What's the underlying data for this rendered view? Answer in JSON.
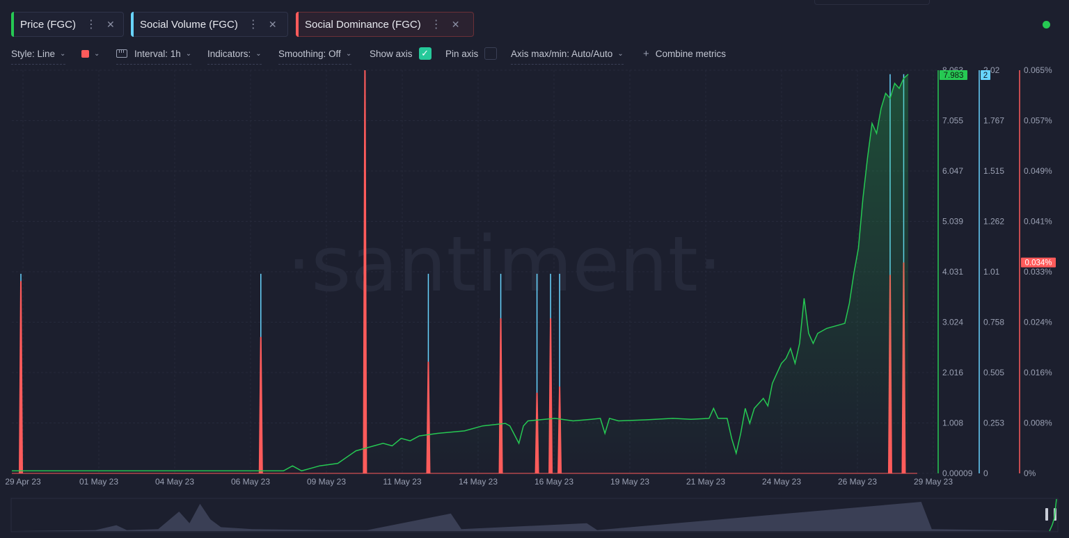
{
  "tabs": [
    {
      "label": "Price (FGC)",
      "color": "#26c953"
    },
    {
      "label": "Social Volume (FGC)",
      "color": "#68d4ff"
    },
    {
      "label": "Social Dominance (FGC)",
      "color": "#ff5b5b"
    }
  ],
  "toolbar": {
    "style_label": "Style: Line",
    "interval_label": "Interval: 1h",
    "indicators_label": "Indicators:",
    "smoothing_label": "Smoothing: Off",
    "show_axis_label": "Show axis",
    "pin_axis_label": "Pin axis",
    "axis_maxmin_label": "Axis max/min: Auto/Auto",
    "combine_label": "Combine metrics",
    "swatch_color": "#ff5b5b",
    "show_axis_checked": true,
    "pin_axis_checked": false
  },
  "status_color": "#26c953",
  "watermark": "·santiment·",
  "chart_data": {
    "type": "line",
    "x_tick_labels": [
      "29 Apr 23",
      "01 May 23",
      "04 May 23",
      "06 May 23",
      "09 May 23",
      "11 May 23",
      "14 May 23",
      "16 May 23",
      "19 May 23",
      "21 May 23",
      "24 May 23",
      "26 May 23",
      "29 May 23"
    ],
    "axes": [
      {
        "metric": "Price (FGC)",
        "color": "#26c953",
        "ticks": [
          "8.063",
          "7.055",
          "6.047",
          "5.039",
          "4.031",
          "3.024",
          "2.016",
          "1.008",
          "0.00009"
        ],
        "range": [
          9e-05,
          8.063
        ],
        "current": "7.983"
      },
      {
        "metric": "Social Volume (FGC)",
        "color": "#68d4ff",
        "ticks": [
          "2.02",
          "1.767",
          "1.515",
          "1.262",
          "1.01",
          "0.758",
          "0.505",
          "0.253",
          "0"
        ],
        "range": [
          0,
          2.02
        ],
        "current": "2"
      },
      {
        "metric": "Social Dominance (FGC)",
        "color": "#ff5b5b",
        "ticks": [
          "0.065%",
          "0.057%",
          "0.049%",
          "0.041%",
          "0.033%",
          "0.024%",
          "0.016%",
          "0.008%",
          "0%"
        ],
        "range": [
          0,
          0.065
        ],
        "current": "0.034%"
      }
    ],
    "series": [
      {
        "name": "Price (FGC)",
        "color": "#26c953",
        "points": [
          [
            0,
            0.05
          ],
          [
            0.3,
            0.05
          ],
          [
            0.31,
            0.15
          ],
          [
            0.32,
            0.05
          ],
          [
            0.33,
            0.1
          ],
          [
            0.34,
            0.15
          ],
          [
            0.36,
            0.2
          ],
          [
            0.38,
            0.45
          ],
          [
            0.39,
            0.5
          ],
          [
            0.41,
            0.6
          ],
          [
            0.42,
            0.55
          ],
          [
            0.43,
            0.7
          ],
          [
            0.44,
            0.65
          ],
          [
            0.45,
            0.75
          ],
          [
            0.47,
            0.8
          ],
          [
            0.5,
            0.85
          ],
          [
            0.52,
            0.95
          ],
          [
            0.545,
            1.0
          ],
          [
            0.55,
            0.95
          ],
          [
            0.56,
            0.6
          ],
          [
            0.565,
            0.95
          ],
          [
            0.57,
            1.05
          ],
          [
            0.6,
            1.1
          ],
          [
            0.62,
            1.05
          ],
          [
            0.64,
            1.08
          ],
          [
            0.65,
            1.1
          ],
          [
            0.655,
            0.8
          ],
          [
            0.66,
            1.1
          ],
          [
            0.67,
            1.05
          ],
          [
            0.7,
            1.07
          ],
          [
            0.73,
            1.1
          ],
          [
            0.75,
            1.08
          ],
          [
            0.77,
            1.1
          ],
          [
            0.775,
            1.3
          ],
          [
            0.78,
            1.1
          ],
          [
            0.79,
            1.1
          ],
          [
            0.795,
            0.7
          ],
          [
            0.8,
            0.4
          ],
          [
            0.805,
            0.8
          ],
          [
            0.81,
            1.3
          ],
          [
            0.815,
            1.0
          ],
          [
            0.82,
            1.3
          ],
          [
            0.83,
            1.5
          ],
          [
            0.835,
            1.35
          ],
          [
            0.84,
            1.8
          ],
          [
            0.845,
            2.0
          ],
          [
            0.85,
            2.2
          ],
          [
            0.855,
            2.3
          ],
          [
            0.86,
            2.5
          ],
          [
            0.865,
            2.2
          ],
          [
            0.87,
            2.6
          ],
          [
            0.875,
            3.5
          ],
          [
            0.88,
            2.8
          ],
          [
            0.885,
            2.6
          ],
          [
            0.89,
            2.8
          ],
          [
            0.9,
            2.9
          ],
          [
            0.91,
            2.95
          ],
          [
            0.92,
            3.0
          ],
          [
            0.925,
            3.4
          ],
          [
            0.93,
            4.0
          ],
          [
            0.935,
            4.5
          ],
          [
            0.94,
            5.5
          ],
          [
            0.945,
            6.3
          ],
          [
            0.95,
            7.0
          ],
          [
            0.955,
            6.8
          ],
          [
            0.96,
            7.3
          ],
          [
            0.965,
            7.6
          ],
          [
            0.97,
            7.5
          ],
          [
            0.975,
            7.8
          ],
          [
            0.98,
            7.7
          ],
          [
            0.985,
            7.9
          ],
          [
            0.99,
            7.983
          ]
        ]
      },
      {
        "name": "Social Volume (FGC)",
        "color": "#68d4ff",
        "spikes": [
          [
            0.01,
            1
          ],
          [
            0.275,
            1
          ],
          [
            0.39,
            2
          ],
          [
            0.46,
            1
          ],
          [
            0.54,
            1
          ],
          [
            0.58,
            1
          ],
          [
            0.595,
            1
          ],
          [
            0.605,
            1
          ],
          [
            0.97,
            2
          ],
          [
            0.985,
            2
          ]
        ]
      },
      {
        "name": "Social Dominance (FGC)",
        "color": "#ff5b5b",
        "spikes": [
          [
            0.01,
            0.031
          ],
          [
            0.275,
            0.022
          ],
          [
            0.39,
            0.065
          ],
          [
            0.46,
            0.018
          ],
          [
            0.54,
            0.025
          ],
          [
            0.58,
            0.013
          ],
          [
            0.595,
            0.025
          ],
          [
            0.605,
            0.014
          ],
          [
            0.97,
            0.032
          ],
          [
            0.985,
            0.034
          ]
        ]
      }
    ],
    "grid": true
  }
}
